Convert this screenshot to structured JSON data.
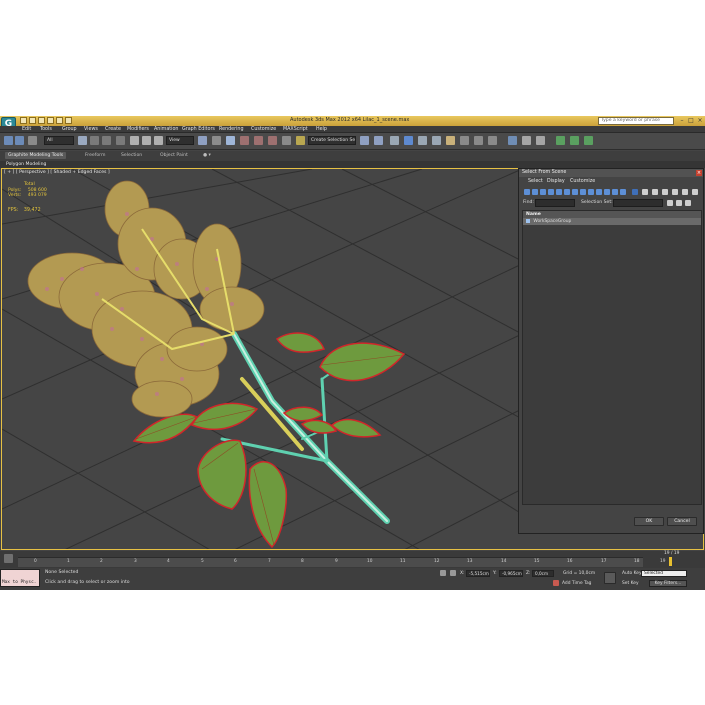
{
  "window": {
    "app_logo": "G",
    "title": "Autodesk 3ds Max 2012 x64    Lilac_1_scene.max",
    "search_placeholder": "Type a keyword or phrase"
  },
  "menu": [
    "Edit",
    "Tools",
    "Group",
    "Views",
    "Create",
    "Modifiers",
    "Animation",
    "Graph Editors",
    "Rendering",
    "Customize",
    "MAXScript",
    "Help"
  ],
  "toolbar": {
    "filter_value": "All",
    "view_value": "View",
    "selection_set_value": "Create Selection Se"
  },
  "ribbon": {
    "tabs": [
      "Graphite Modeling Tools",
      "Freeform",
      "Selection",
      "Object Paint"
    ],
    "panel_label": "Polygon Modeling"
  },
  "viewport": {
    "label": "[ + ] [ Perspective ] [ Shaded + Edged Faces ]",
    "stats_total_label": "Total",
    "polys_label": "Polys:",
    "polys_value": "508 600",
    "verts_label": "Verts:",
    "verts_value": "493 079",
    "fps_label": "FPS:",
    "fps_value": "39,472"
  },
  "dialog": {
    "title": "Select From Scene",
    "close_glyph": "×",
    "menu": [
      "Select",
      "Display",
      "Customize"
    ],
    "find_label": "Find:",
    "selection_set_label": "Selection Set:",
    "column_header": "Name",
    "rows": [
      "WorkSpaceGroup"
    ],
    "ok_label": "OK",
    "cancel_label": "Cancel"
  },
  "timeline": {
    "slider_label": "19 / 19",
    "ticks": [
      "0",
      "1",
      "2",
      "3",
      "4",
      "5",
      "6",
      "7",
      "8",
      "9",
      "10",
      "11",
      "12",
      "13",
      "14",
      "15",
      "16",
      "17",
      "18",
      "19"
    ]
  },
  "status": {
    "maxscript_text": "Max to Physc.",
    "selection_text": "None Selected",
    "prompt_text": "Click and drag to select or zoom into",
    "x_label": "X:",
    "x_value": "-5,515cm",
    "y_label": "Y:",
    "y_value": "-0,965cm",
    "z_label": "Z:",
    "z_value": "0,0cm",
    "grid_label": "Grid = 10,0cm",
    "autokey_label": "Auto Key",
    "selected_value": "Selected",
    "setkey_label": "Set Key",
    "key_filters_label": "Key Filters...",
    "add_time_tag_label": "Add Time Tag"
  },
  "colors": {
    "title_gold": "#caa13a",
    "viewport_border": "#e7c144",
    "stats_yellow": "#e3c43c",
    "blossom": "#b39a52",
    "leaf_green": "#6e9a3e",
    "leaf_edge": "#d0262a",
    "stem_cyan": "#5fd1b0",
    "stem_yellow": "#d9cf5a"
  }
}
